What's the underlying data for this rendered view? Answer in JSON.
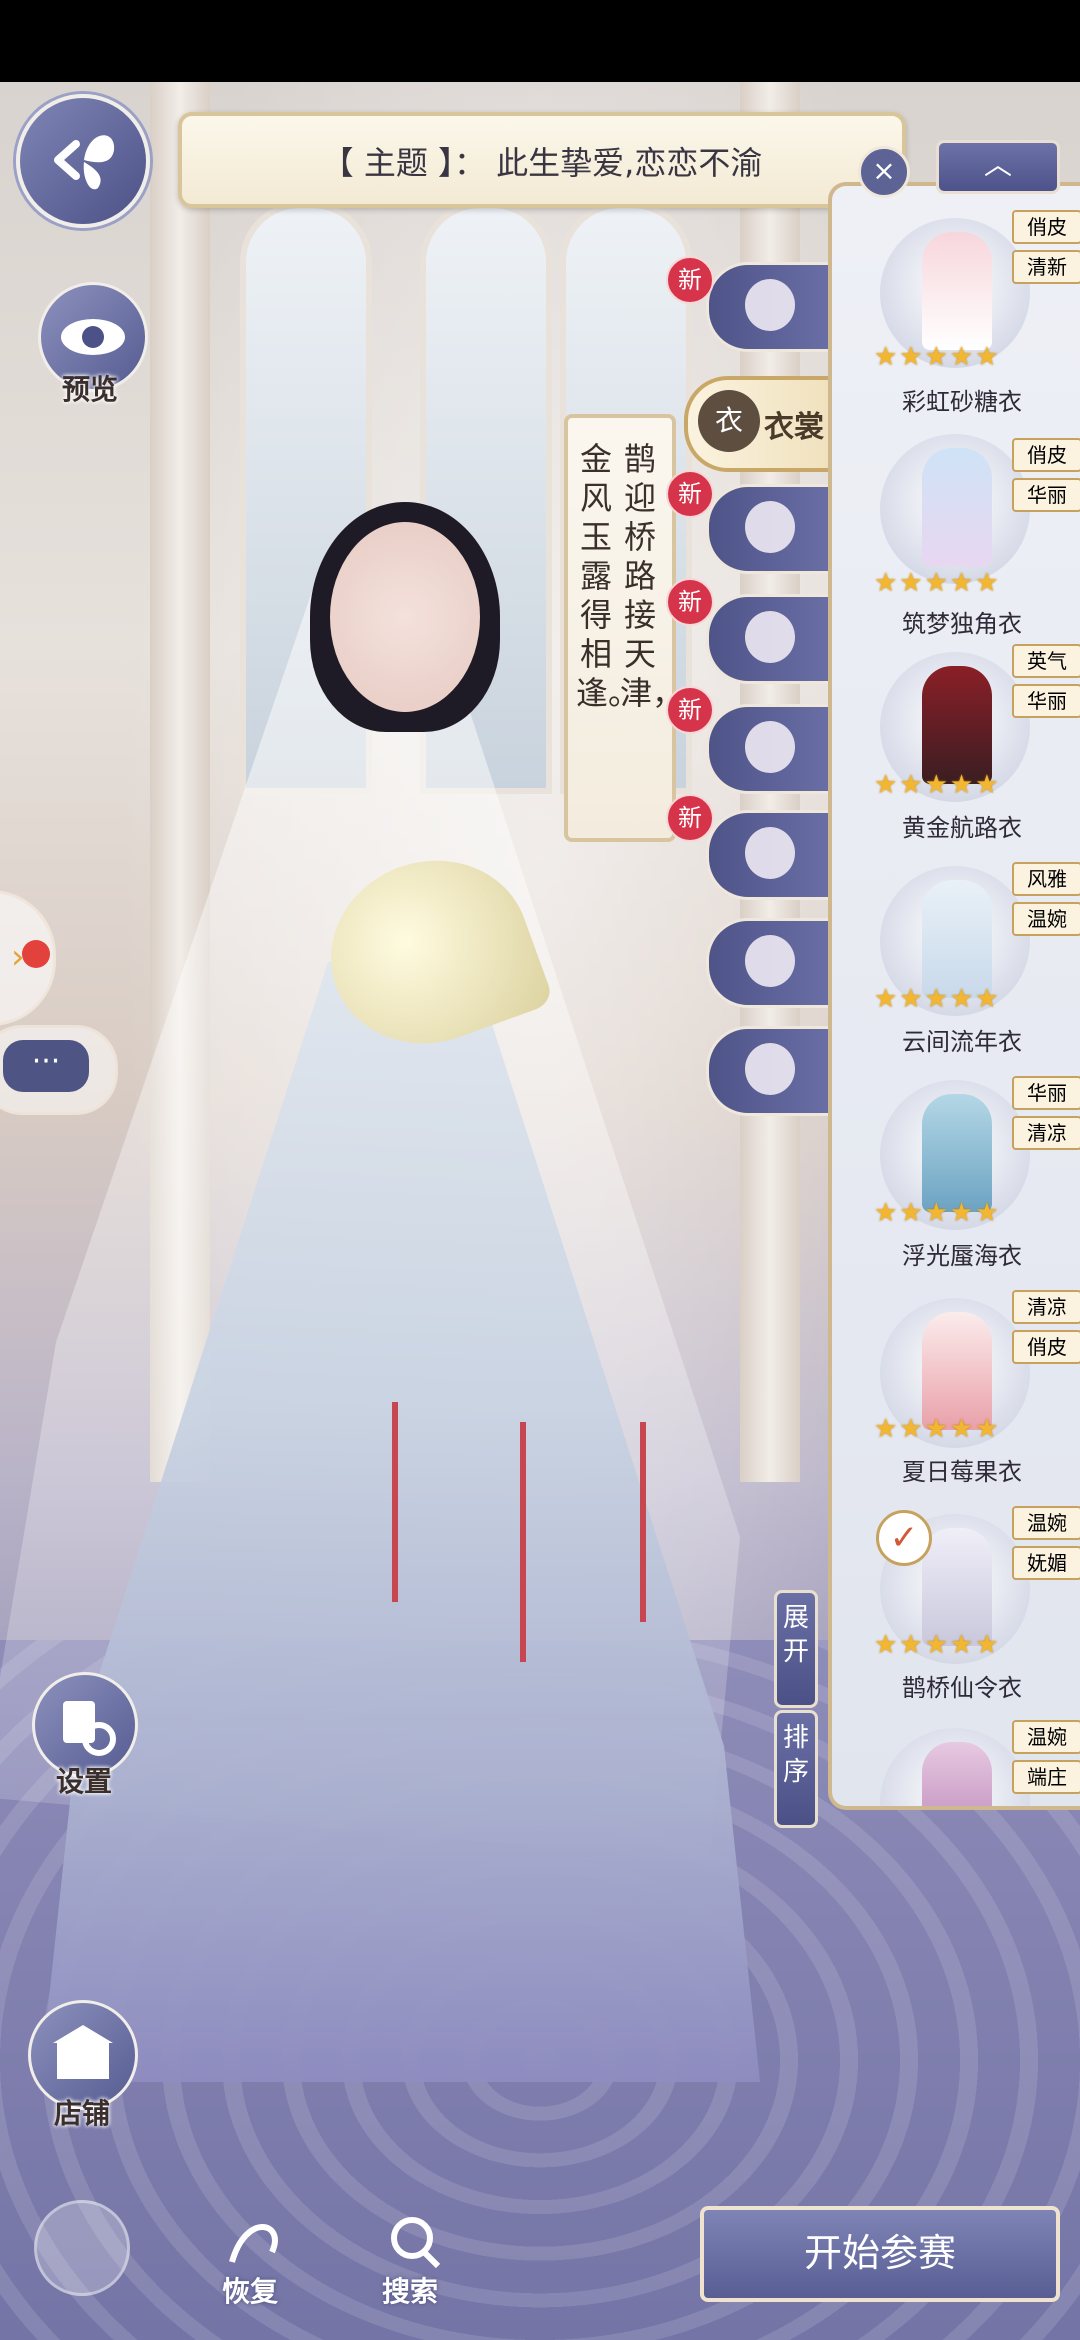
{
  "theme": {
    "text": "【 主题 】：  此生挚爱,恋恋不渝"
  },
  "left_buttons": {
    "preview_label": "预览",
    "settings_label": "设置",
    "shop_label": "店铺"
  },
  "poem": {
    "line1": "鹊迎桥路接天津，",
    "line2": "金风玉露得相逢。"
  },
  "category_tabs": {
    "new_badge": "新",
    "active_label": "衣裳"
  },
  "panel_controls": {
    "close": "×",
    "collapse": "︿"
  },
  "items": [
    {
      "name": "彩虹砂糖衣",
      "tags": [
        "俏皮",
        "清新"
      ],
      "stars": "★★★★★",
      "colors": [
        "#f7d6dc",
        "#ffffff"
      ]
    },
    {
      "name": "筑梦独角衣",
      "tags": [
        "俏皮",
        "华丽"
      ],
      "stars": "★★★★★",
      "colors": [
        "#cfe3f6",
        "#e8d7f1"
      ]
    },
    {
      "name": "黄金航路衣",
      "tags": [
        "英气",
        "华丽"
      ],
      "stars": "★★★★★",
      "colors": [
        "#8b1f27",
        "#3a1e22"
      ]
    },
    {
      "name": "云间流年衣",
      "tags": [
        "风雅",
        "温婉"
      ],
      "stars": "★★★★★",
      "colors": [
        "#e9f1f7",
        "#c8d9ea"
      ]
    },
    {
      "name": "浮光蜃海衣",
      "tags": [
        "华丽",
        "清凉"
      ],
      "stars": "★★★★★",
      "colors": [
        "#b4d7e6",
        "#6ca3c2"
      ]
    },
    {
      "name": "夏日莓果衣",
      "tags": [
        "清凉",
        "俏皮"
      ],
      "stars": "★★★★★",
      "colors": [
        "#fbecec",
        "#e9a0a9"
      ]
    },
    {
      "name": "鹊桥仙令衣",
      "tags": [
        "温婉",
        "妩媚"
      ],
      "stars": "★★★★★",
      "colors": [
        "#f0eef7",
        "#c9c8dc"
      ]
    },
    {
      "name": "",
      "tags": [
        "温婉",
        "端庄"
      ],
      "stars": "",
      "colors": [
        "#e7c9e2",
        "#b77fb3"
      ]
    }
  ],
  "side_vertical_buttons": {
    "expand": "展开",
    "sort": "排序"
  },
  "bottom_bar": {
    "restore_label": "恢复",
    "search_label": "搜索",
    "start_label": "开始参赛"
  },
  "chat": {
    "label": "···"
  }
}
